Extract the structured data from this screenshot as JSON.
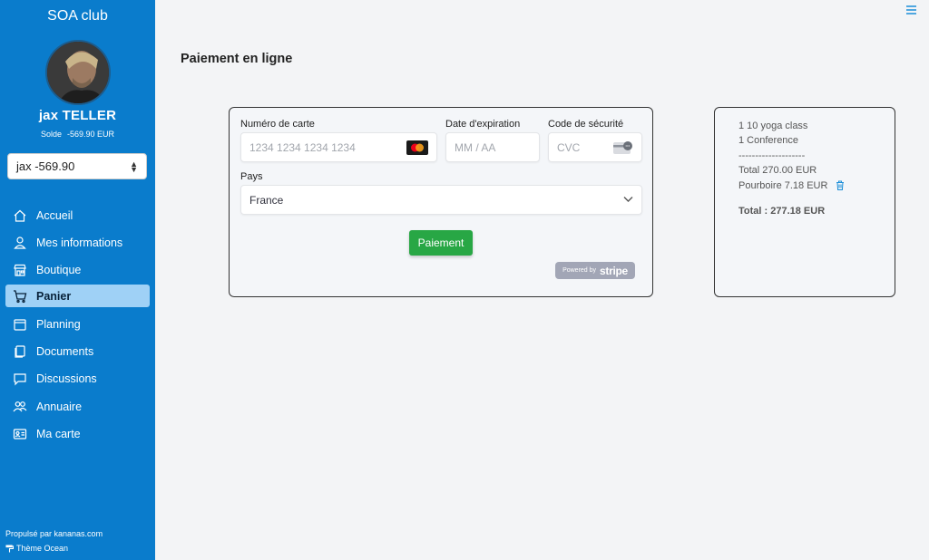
{
  "sidebar": {
    "club_name": "SOA club",
    "user_name": "jax TELLER",
    "solde_label": "Solde",
    "solde_value": "-569.90 EUR",
    "account_select": "jax -569.90",
    "items": [
      {
        "label": "Accueil",
        "icon": "home-icon"
      },
      {
        "label": "Mes informations",
        "icon": "user-icon"
      },
      {
        "label": "Boutique",
        "icon": "store-icon"
      },
      {
        "label": "Panier",
        "icon": "cart-icon",
        "active": true
      },
      {
        "label": "Planning",
        "icon": "calendar-icon"
      },
      {
        "label": "Documents",
        "icon": "documents-icon"
      },
      {
        "label": "Discussions",
        "icon": "chat-icon"
      },
      {
        "label": "Annuaire",
        "icon": "people-icon"
      },
      {
        "label": "Ma carte",
        "icon": "id-card-icon"
      }
    ],
    "footer_powered": "Propulsé par kananas.com",
    "footer_theme": "Thème Ocean"
  },
  "main": {
    "title": "Paiement en ligne",
    "payment_form": {
      "card_number_label": "Numéro de carte",
      "card_number_placeholder": "1234 1234 1234 1234",
      "expiry_label": "Date d'expiration",
      "expiry_placeholder": "MM / AA",
      "cvc_label": "Code de sécurité",
      "cvc_placeholder": "CVC",
      "country_label": "Pays",
      "country_value": "France",
      "pay_button": "Paiement",
      "powered_by": "Powered by",
      "stripe": "stripe"
    },
    "summary": {
      "items": [
        "1 10 yoga class",
        "1 Conference"
      ],
      "separator": "--------------------",
      "total": "Total 270.00 EUR",
      "tip": "Pourboire 7.18 EUR",
      "grand_total": "Total : 277.18 EUR"
    }
  },
  "colors": {
    "sidebar_bg": "#0a7ccc",
    "active_item_bg": "#9fd1f6",
    "pay_button_bg": "#28a745",
    "page_bg": "#f3f4f6",
    "accent": "#1a8dd8"
  }
}
